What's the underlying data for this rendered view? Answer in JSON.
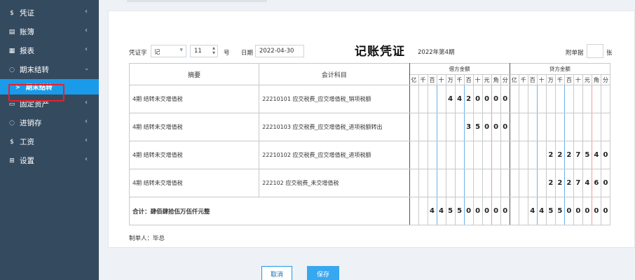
{
  "sidebar": {
    "items": [
      {
        "label": "凭证",
        "icon": "dollar-icon"
      },
      {
        "label": "账簿",
        "icon": "book-icon"
      },
      {
        "label": "报表",
        "icon": "report-icon"
      },
      {
        "label": "期末结转",
        "icon": "cycle-icon",
        "expanded": true
      },
      {
        "label": "固定资产",
        "icon": "monitor-icon"
      },
      {
        "label": "进销存",
        "icon": "cycle-icon"
      },
      {
        "label": "工资",
        "icon": "dollar-icon"
      },
      {
        "label": "设置",
        "icon": "grid-icon"
      }
    ],
    "sub_item": "期末结转"
  },
  "voucher": {
    "word_label": "凭证字",
    "word_value": "记",
    "number_value": "11",
    "number_unit": "号",
    "date_label": "日期",
    "date_value": "2022-04-30",
    "title": "记账凭证",
    "period": "2022年第4期",
    "attach_label": "附单据",
    "attach_unit": "张",
    "maker": "制单人：毕总"
  },
  "table": {
    "col_summary": "摘要",
    "col_account": "会计科目",
    "col_debit": "借方金额",
    "col_credit": "贷方金额",
    "digit_headers": [
      "亿",
      "千",
      "百",
      "十",
      "万",
      "千",
      "百",
      "十",
      "元",
      "角",
      "分"
    ],
    "rows": [
      {
        "summary": "4期 结转未交增值税",
        "account": "22210101 应交税费_应交增值税_销项税额",
        "debit": [
          "",
          "",
          "",
          "",
          "4",
          "4",
          "2",
          "0",
          "0",
          "0",
          "0"
        ],
        "credit": [
          "",
          "",
          "",
          "",
          "",
          "",
          "",
          "",
          "",
          "",
          ""
        ]
      },
      {
        "summary": "4期 结转未交增值税",
        "account": "22210103 应交税费_应交增值税_进项税额转出",
        "debit": [
          "",
          "",
          "",
          "",
          "",
          "",
          "3",
          "5",
          "0",
          "0",
          "0"
        ],
        "credit": [
          "",
          "",
          "",
          "",
          "",
          "",
          "",
          "",
          "",
          "",
          ""
        ]
      },
      {
        "summary": "4期 结转未交增值税",
        "account": "22210102 应交税费_应交增值税_进项税额",
        "debit": [
          "",
          "",
          "",
          "",
          "",
          "",
          "",
          "",
          "",
          "",
          ""
        ],
        "credit": [
          "",
          "",
          "",
          "",
          "",
          "2",
          "2",
          "2",
          "7",
          "5",
          "4",
          "0"
        ]
      },
      {
        "summary": "4期 结转未交增值税",
        "account": "222102 应交税费_未交增值税",
        "debit": [
          "",
          "",
          "",
          "",
          "",
          "",
          "",
          "",
          "",
          "",
          ""
        ],
        "credit": [
          "",
          "",
          "",
          "",
          "",
          "2",
          "2",
          "2",
          "7",
          "4",
          "6",
          "0"
        ]
      }
    ],
    "total_label": "合计：肆佰肆拾伍万伍仟元整",
    "total_debit": [
      "",
      "",
      "4",
      "4",
      "5",
      "5",
      "0",
      "0",
      "0",
      "0",
      "0"
    ],
    "total_credit": [
      "",
      "",
      "4",
      "4",
      "5",
      "5",
      "0",
      "0",
      "0",
      "0",
      "0"
    ]
  },
  "buttons": {
    "cancel": "取消",
    "save": "保存"
  }
}
